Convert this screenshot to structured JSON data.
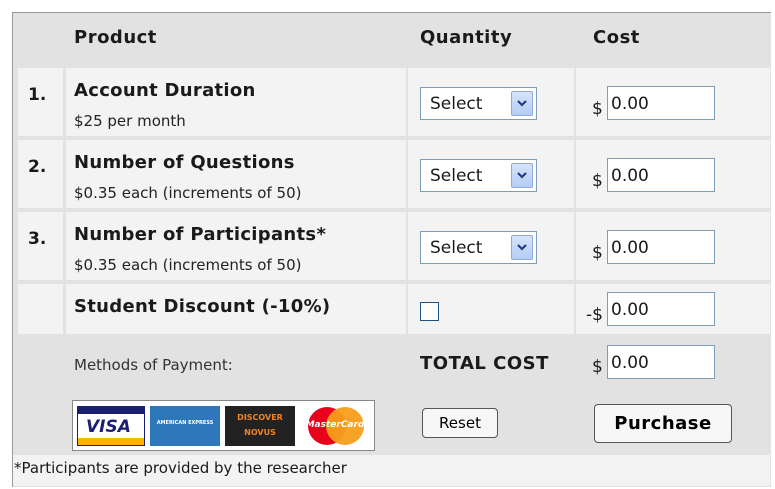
{
  "headers": {
    "product": "Product",
    "quantity": "Quantity",
    "cost": "Cost"
  },
  "rows": [
    {
      "num": "1.",
      "name": "Account Duration",
      "sub": "$25 per month",
      "select": "Select",
      "currency": "$",
      "cost": "0.00"
    },
    {
      "num": "2.",
      "name": "Number of Questions",
      "sub": "$0.35 each (increments of 50)",
      "select": "Select",
      "currency": "$",
      "cost": "0.00"
    },
    {
      "num": "3.",
      "name": "Number of Participants*",
      "sub": "$0.35 each (increments of 50)",
      "select": "Select",
      "currency": "$",
      "cost": "0.00"
    }
  ],
  "discount": {
    "label": "Student Discount (-10%)",
    "checked": false,
    "currency": "-$",
    "cost": "0.00"
  },
  "payment": {
    "label": "Methods of Payment:",
    "cards": [
      "VISA",
      "AMERICAN EXPRESS",
      "DISCOVER NOVUS",
      "MasterCard"
    ]
  },
  "total": {
    "label": "TOTAL COST",
    "currency": "$",
    "value": "0.00"
  },
  "buttons": {
    "reset": "Reset",
    "purchase": "Purchase"
  },
  "footnote": "*Participants are provided by the researcher",
  "colors": {
    "panel": "#e2e2e2",
    "cell": "#f3f3f3",
    "field_border": "#7f9db9",
    "visa_blue": "#1a1f71",
    "amex_blue": "#2e77bb",
    "mastercard_red": "#eb001b",
    "mastercard_orange": "#f79e1b",
    "discover_orange": "#f58220"
  }
}
